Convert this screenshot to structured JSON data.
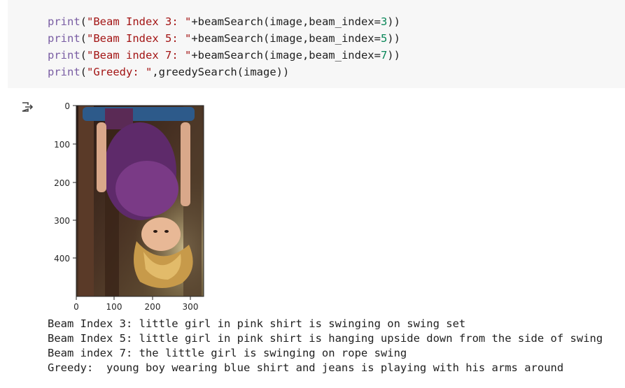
{
  "code": {
    "lines": [
      {
        "fn": "print",
        "open": "(",
        "str": "\"Beam Index 3: \"",
        "rest1": "+beamSearch(image,beam_index=",
        "num": "3",
        "rest2": "))"
      },
      {
        "fn": "print",
        "open": "(",
        "str": "\"Beam Index 5: \"",
        "rest1": "+beamSearch(image,beam_index=",
        "num": "5",
        "rest2": "))"
      },
      {
        "fn": "print",
        "open": "(",
        "str": "\"Beam index 7: \"",
        "rest1": "+beamSearch(image,beam_index=",
        "num": "7",
        "rest2": "))"
      },
      {
        "fn": "print",
        "open": "(",
        "str": "\"Greedy: \"",
        "rest1": ",greedySearch(image))",
        "num": "",
        "rest2": ""
      }
    ]
  },
  "output": {
    "icon": "output-arrow-icon",
    "plot": {
      "y_ticks": [
        "0",
        "100",
        "200",
        "300",
        "400"
      ],
      "x_ticks": [
        "0",
        "100",
        "200",
        "300"
      ]
    },
    "lines": [
      "Beam Index 3: little girl in pink shirt is swinging on swing set",
      "Beam Index 5: little girl in pink shirt is hanging upside down from the side of swing",
      "Beam index 7: the little girl is swinging on rope swing",
      "Greedy:  young boy wearing blue shirt and jeans is playing with his arms around"
    ]
  },
  "colors": {
    "cell_bg": "#f7f7f7",
    "keyword": "#795da3",
    "string": "#a31515",
    "number": "#098658"
  }
}
